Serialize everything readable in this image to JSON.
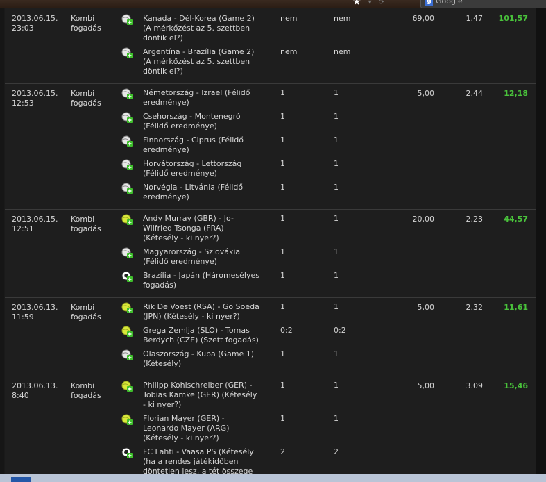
{
  "browser": {
    "search_placeholder": "Google",
    "search_provider": "g"
  },
  "accent_win_color": "#49c23b",
  "bets": [
    {
      "date": "2013.06.15.",
      "time": "23:03",
      "type_line1": "Kombi",
      "type_line2": "fogadás",
      "stake": "69,00",
      "odds": "1.47",
      "win": "101,57",
      "selections": [
        {
          "icon": "volleyball-icon",
          "event": "Kanada - Dél-Korea (Game 2) (A mérkőzést az 5. szettben döntik el?)",
          "tip": "nem",
          "result": "nem"
        },
        {
          "icon": "volleyball-icon",
          "event": "Argentína - Brazília (Game 2) (A mérkőzést az 5. szettben döntik el?)",
          "tip": "nem",
          "result": "nem"
        }
      ]
    },
    {
      "date": "2013.06.15.",
      "time": "12:53",
      "type_line1": "Kombi",
      "type_line2": "fogadás",
      "stake": "5,00",
      "odds": "2.44",
      "win": "12,18",
      "selections": [
        {
          "icon": "handball-icon",
          "event": "Németország - Izrael (Félidő eredménye)",
          "tip": "1",
          "result": "1"
        },
        {
          "icon": "handball-icon",
          "event": "Csehország - Montenegró (Félidő eredménye)",
          "tip": "1",
          "result": "1"
        },
        {
          "icon": "handball-icon",
          "event": "Finnország - Ciprus (Félidő eredménye)",
          "tip": "1",
          "result": "1"
        },
        {
          "icon": "handball-icon",
          "event": "Horvátország - Lettország (Félidő eredménye)",
          "tip": "1",
          "result": "1"
        },
        {
          "icon": "handball-icon",
          "event": "Norvégia - Litvánia (Félidő eredménye)",
          "tip": "1",
          "result": "1"
        }
      ]
    },
    {
      "date": "2013.06.15.",
      "time": "12:51",
      "type_line1": "Kombi",
      "type_line2": "fogadás",
      "stake": "20,00",
      "odds": "2.23",
      "win": "44,57",
      "selections": [
        {
          "icon": "tennis-icon",
          "event": "Andy Murray (GBR) - Jo-Wilfried Tsonga (FRA) (Kétesély - ki nyer?)",
          "tip": "1",
          "result": "1"
        },
        {
          "icon": "handball-icon",
          "event": "Magyarország - Szlovákia (Félidő eredménye)",
          "tip": "1",
          "result": "1"
        },
        {
          "icon": "soccer-icon",
          "event": "Brazília - Japán (Háromesélyes fogadás)",
          "tip": "1",
          "result": "1"
        }
      ]
    },
    {
      "date": "2013.06.13.",
      "time": "11:59",
      "type_line1": "Kombi",
      "type_line2": "fogadás",
      "stake": "5,00",
      "odds": "2.32",
      "win": "11,61",
      "selections": [
        {
          "icon": "tennis-icon",
          "event": "Rik De Voest (RSA) - Go Soeda (JPN) (Kétesély - ki nyer?)",
          "tip": "1",
          "result": "1"
        },
        {
          "icon": "tennis-icon",
          "event": "Grega Zemlja (SLO) - Tomas Berdych (CZE) (Szett fogadás)",
          "tip": "0:2",
          "result": "0:2"
        },
        {
          "icon": "volleyball-icon",
          "event": "Olaszország - Kuba (Game 1) (Kétesély)",
          "tip": "1",
          "result": "1"
        }
      ]
    },
    {
      "date": "2013.06.13.",
      "time": "8:40",
      "type_line1": "Kombi",
      "type_line2": "fogadás",
      "stake": "5,00",
      "odds": "3.09",
      "win": "15,46",
      "selections": [
        {
          "icon": "tennis-icon",
          "event": "Philipp Kohlschreiber (GER) - Tobias Kamke (GER) (Kétesély - ki nyer?)",
          "tip": "1",
          "result": "1"
        },
        {
          "icon": "tennis-icon",
          "event": "Florian Mayer (GER) - Leonardo Mayer (ARG) (Kétesély - ki nyer?)",
          "tip": "1",
          "result": "1"
        },
        {
          "icon": "soccer-icon",
          "event": "FC Lahti - Vaasa PS (Kétesély (ha a rendes játékidőben döntetlen lesz, a tét összege visszajár))",
          "tip": "2",
          "result": "2"
        }
      ]
    }
  ]
}
